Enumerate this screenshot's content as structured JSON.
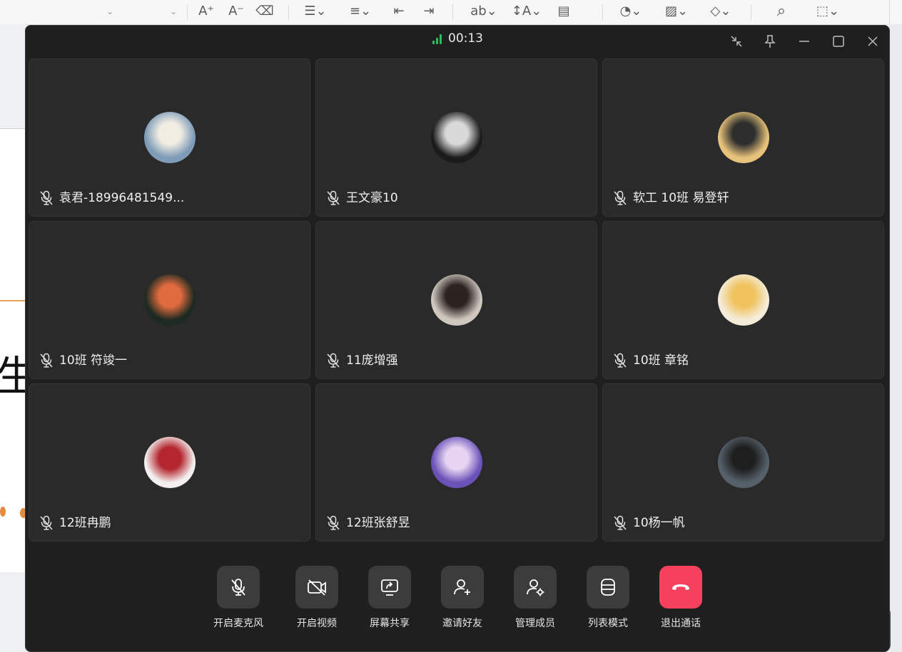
{
  "call": {
    "timer": "00:13",
    "signal_color": "#2bbd58",
    "window_controls": [
      "shrink-icon",
      "pin-icon",
      "minimize-icon",
      "maximize-icon",
      "close-icon"
    ]
  },
  "participants": [
    {
      "name": "袁君-18996481549...",
      "muted": true,
      "avatar_colors": [
        "#7e9cb7",
        "#f1ede3"
      ]
    },
    {
      "name": "王文豪10",
      "muted": true,
      "avatar_colors": [
        "#1b1b1b",
        "#d9d9d9"
      ]
    },
    {
      "name": "软工 10班 易登轩",
      "muted": true,
      "avatar_colors": [
        "#e6c27a",
        "#2e2e2e"
      ]
    },
    {
      "name": "10班 符竣一",
      "muted": true,
      "avatar_colors": [
        "#1d2a22",
        "#e06b3e"
      ]
    },
    {
      "name": "11庞增强",
      "muted": true,
      "avatar_colors": [
        "#cfc8bf",
        "#2a2320"
      ]
    },
    {
      "name": "10班 章铭",
      "muted": true,
      "avatar_colors": [
        "#f4ecd9",
        "#f0c35e"
      ]
    },
    {
      "name": "12班冉鹏",
      "muted": true,
      "avatar_colors": [
        "#f3efee",
        "#b3262e"
      ]
    },
    {
      "name": "12班张舒昱",
      "muted": true,
      "avatar_colors": [
        "#6a52b8",
        "#e7d4f2"
      ]
    },
    {
      "name": "10杨一帆",
      "muted": true,
      "avatar_colors": [
        "#55606a",
        "#1e1e1e"
      ]
    }
  ],
  "controls": [
    {
      "label": "开启麦克风",
      "icon": "mic-off-icon"
    },
    {
      "label": "开启视频",
      "icon": "camera-off-icon"
    },
    {
      "label": "屏幕共享",
      "icon": "screen-share-icon"
    },
    {
      "label": "邀请好友",
      "icon": "add-user-icon"
    },
    {
      "label": "管理成员",
      "icon": "manage-members-icon"
    },
    {
      "label": "列表模式",
      "icon": "list-mode-icon"
    },
    {
      "label": "退出通话",
      "icon": "hang-up-icon",
      "color": "#f5405e"
    }
  ],
  "background_app": {
    "page_char": "生",
    "toolbar_icons": [
      "font-increase-icon",
      "font-decrease-icon",
      "clear-format-icon",
      "bullet-list-icon",
      "numbered-list-icon",
      "decrease-indent-icon",
      "increase-indent-icon",
      "text-style-icon",
      "line-spacing-icon",
      "text-box-icon",
      "shape-icon",
      "image-icon",
      "fill-icon",
      "search-icon",
      "select-icon"
    ]
  }
}
